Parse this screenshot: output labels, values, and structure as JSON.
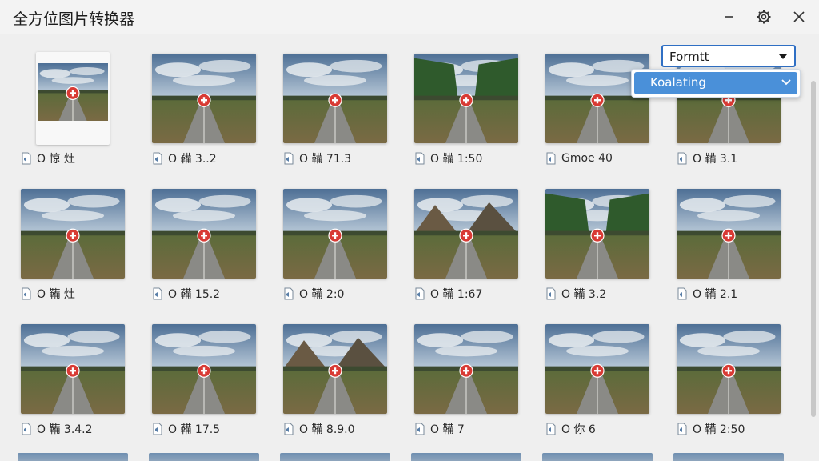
{
  "app": {
    "title": "全方位图片转换器"
  },
  "window_controls": [
    {
      "name": "minimize",
      "icon": "minimize-icon"
    },
    {
      "name": "settings",
      "icon": "gear-icon"
    },
    {
      "name": "close",
      "icon": "close-icon"
    }
  ],
  "format_select": {
    "value": "Formtt",
    "icon": "chevron-down-icon"
  },
  "dropdown": {
    "item": "Koalating",
    "icon": "chevron-down-icon"
  },
  "images": [
    {
      "label": "O 惊 灶",
      "scene": "road-field"
    },
    {
      "label": "O 鞴 3..2",
      "scene": "road-field"
    },
    {
      "label": "O 鞴 71.3",
      "scene": "road-field"
    },
    {
      "label": "O 鞴 1:50",
      "scene": "road-forest"
    },
    {
      "label": "Gmoe 40",
      "scene": "road-field"
    },
    {
      "label": "O 鞴 3.1",
      "scene": "road-field"
    },
    {
      "label": "O 鞴 灶",
      "scene": "road-field"
    },
    {
      "label": "O 鞴 15.2",
      "scene": "road-field"
    },
    {
      "label": "O 鞴 2:0",
      "scene": "road-field"
    },
    {
      "label": "O 鞴 1:67",
      "scene": "road-mountain"
    },
    {
      "label": "O 鞴 3.2",
      "scene": "road-forest"
    },
    {
      "label": "O 鞴 2.1",
      "scene": "road-field"
    },
    {
      "label": "O 鞴 3.4.2",
      "scene": "road-field"
    },
    {
      "label": "O 鞴 17.5",
      "scene": "road-field"
    },
    {
      "label": "O 鞴 8.9.0",
      "scene": "road-mountain"
    },
    {
      "label": "O 鞴 7",
      "scene": "road-field"
    },
    {
      "label": "O 你 6",
      "scene": "road-field"
    },
    {
      "label": "O 鞴 2:50",
      "scene": "road-field"
    }
  ],
  "colors": {
    "accent": "#2f6fc4",
    "highlight": "#4a90d9",
    "badge": "#d83a34"
  }
}
